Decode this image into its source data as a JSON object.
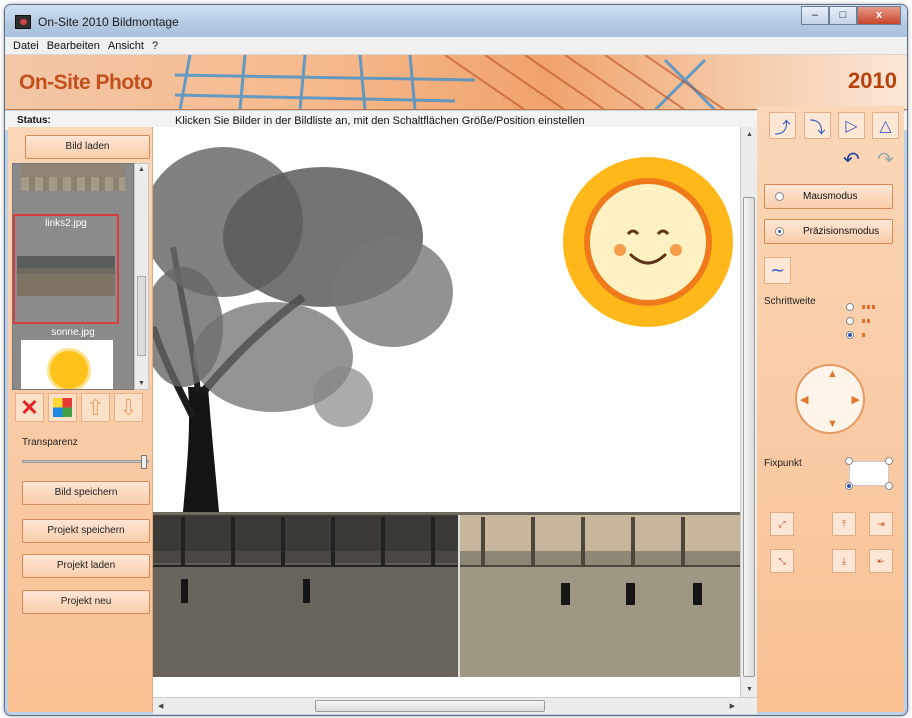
{
  "window": {
    "title": "On-Site 2010 Bildmontage",
    "min": "–",
    "max": "□",
    "close": "x"
  },
  "menu": [
    "Datei",
    "Bearbeiten",
    "Ansicht",
    "?"
  ],
  "banner": {
    "logo": "On-Site Photo",
    "year": "2010"
  },
  "status": {
    "label": "Status:",
    "text": "Klicken Sie Bilder in der Bildliste an, mit den Schaltflächen Größe/Position einstellen"
  },
  "left": {
    "load_button": "Bild laden",
    "thumbnails": [
      {
        "label": "links2.jpg",
        "selected": true
      },
      {
        "label": "sonne.jpg",
        "selected": false
      }
    ],
    "icons": [
      "delete-icon",
      "color-palette-icon",
      "arrow-up-icon",
      "arrow-down-icon"
    ],
    "transparency_label": "Transparenz",
    "transparency_value": 1.0,
    "buttons": [
      "Bild speichern",
      "Projekt speichern",
      "Projekt laden",
      "Projekt neu"
    ]
  },
  "right": {
    "tool_icons": [
      "rotate-left-icon",
      "rotate-right-icon",
      "flip-horizontal-icon",
      "flip-vertical-icon"
    ],
    "undo_icons": [
      "undo-icon",
      "redo-icon"
    ],
    "modes": [
      {
        "label": "Mausmodus",
        "selected": false
      },
      {
        "label": "Präzisionsmodus",
        "selected": true
      }
    ],
    "step_label": "Schrittweite",
    "step_options": [
      "large",
      "medium",
      "small"
    ],
    "step_selected": 2,
    "fixpoint_label": "Fixpunkt"
  },
  "colors": {
    "accent": "#c2501e",
    "panel": "#f8c194",
    "selection": "#d93c3c"
  }
}
